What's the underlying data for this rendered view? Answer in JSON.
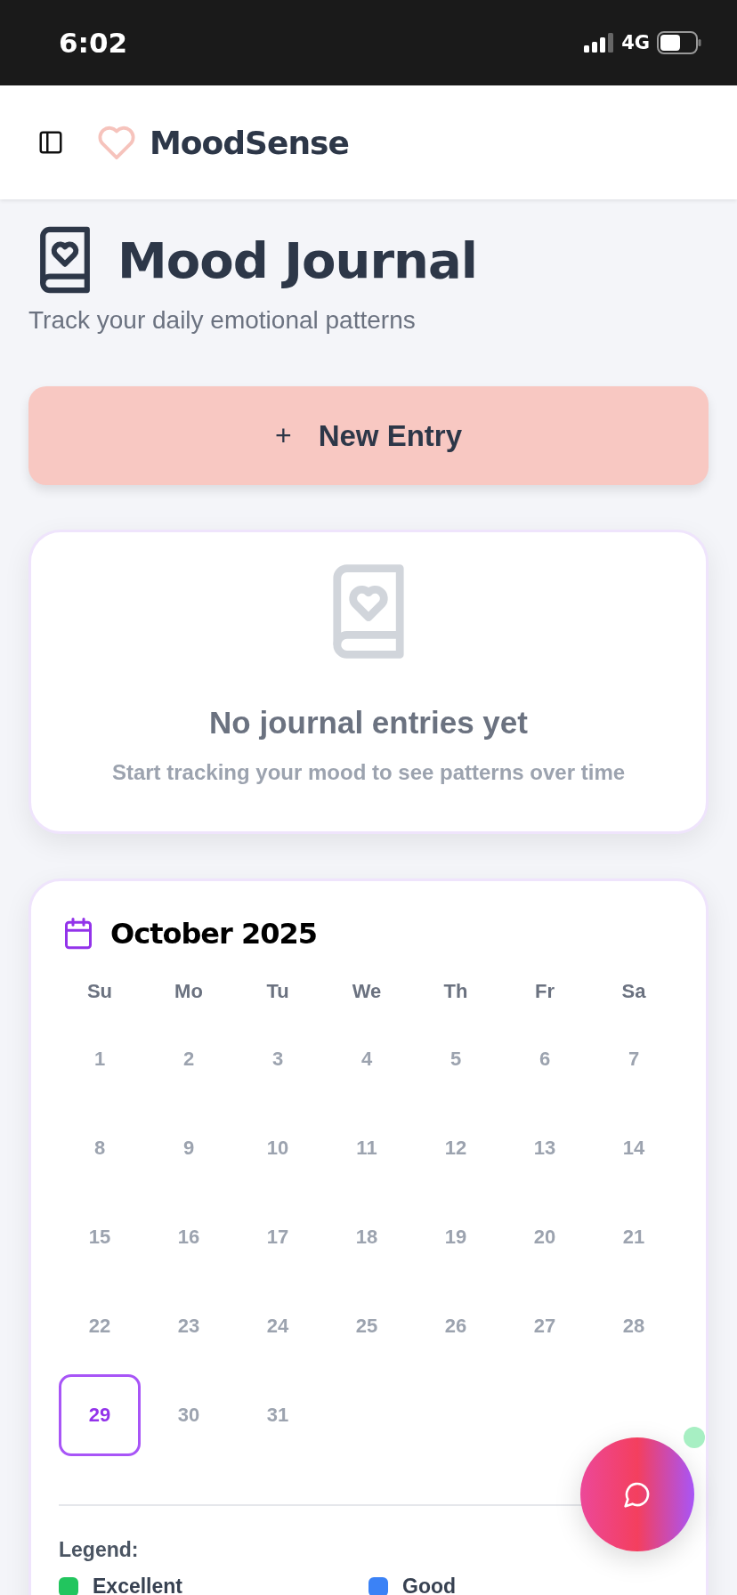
{
  "status_bar": {
    "time": "6:02",
    "network": "4G"
  },
  "header": {
    "app_name": "MoodSense"
  },
  "page": {
    "title": "Mood Journal",
    "subtitle": "Track your daily emotional patterns"
  },
  "new_entry_button": {
    "icon": "+",
    "label": "New Entry"
  },
  "empty_state": {
    "title": "No journal entries yet",
    "message": "Start tracking your mood to see patterns over time"
  },
  "calendar": {
    "month": "October 2025",
    "weekdays": [
      "Su",
      "Mo",
      "Tu",
      "We",
      "Th",
      "Fr",
      "Sa"
    ],
    "weeks": [
      {
        "days": [
          {
            "label": "1",
            "selected": false
          },
          {
            "label": "2",
            "selected": false
          },
          {
            "label": "3",
            "selected": false
          },
          {
            "label": "4",
            "selected": false
          },
          {
            "label": "5",
            "selected": false
          },
          {
            "label": "6",
            "selected": false
          },
          {
            "label": "7",
            "selected": false
          }
        ]
      },
      {
        "days": [
          {
            "label": "8",
            "selected": false
          },
          {
            "label": "9",
            "selected": false
          },
          {
            "label": "10",
            "selected": false
          },
          {
            "label": "11",
            "selected": false
          },
          {
            "label": "12",
            "selected": false
          },
          {
            "label": "13",
            "selected": false
          },
          {
            "label": "14",
            "selected": false
          }
        ]
      },
      {
        "days": [
          {
            "label": "15",
            "selected": false
          },
          {
            "label": "16",
            "selected": false
          },
          {
            "label": "17",
            "selected": false
          },
          {
            "label": "18",
            "selected": false
          },
          {
            "label": "19",
            "selected": false
          },
          {
            "label": "20",
            "selected": false
          },
          {
            "label": "21",
            "selected": false
          }
        ]
      },
      {
        "days": [
          {
            "label": "22",
            "selected": false
          },
          {
            "label": "23",
            "selected": false
          },
          {
            "label": "24",
            "selected": false
          },
          {
            "label": "25",
            "selected": false
          },
          {
            "label": "26",
            "selected": false
          },
          {
            "label": "27",
            "selected": false
          },
          {
            "label": "28",
            "selected": false
          }
        ]
      },
      {
        "days": [
          {
            "label": "29",
            "selected": true
          },
          {
            "label": "30",
            "selected": false
          },
          {
            "label": "31",
            "selected": false
          }
        ]
      }
    ],
    "legend_title": "Legend:",
    "legend": [
      {
        "label": "Excellent",
        "color": "#22c55e"
      },
      {
        "label": "Good",
        "color": "#3b82f6"
      }
    ]
  },
  "chat_button": {
    "online": true
  }
}
